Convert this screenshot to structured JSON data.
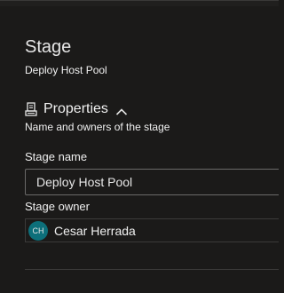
{
  "stage": {
    "title": "Stage",
    "subtitle": "Deploy Host Pool"
  },
  "properties": {
    "title": "Properties",
    "description": "Name and owners of the stage",
    "icon": "properties-icon",
    "expanded": true
  },
  "fields": {
    "stage_name_label": "Stage name",
    "stage_name_value": "Deploy Host Pool",
    "stage_owner_label": "Stage owner",
    "owner_initials": "CH",
    "owner_name": "Cesar Herrada",
    "owner_avatar_color": "#0d6f7a"
  }
}
